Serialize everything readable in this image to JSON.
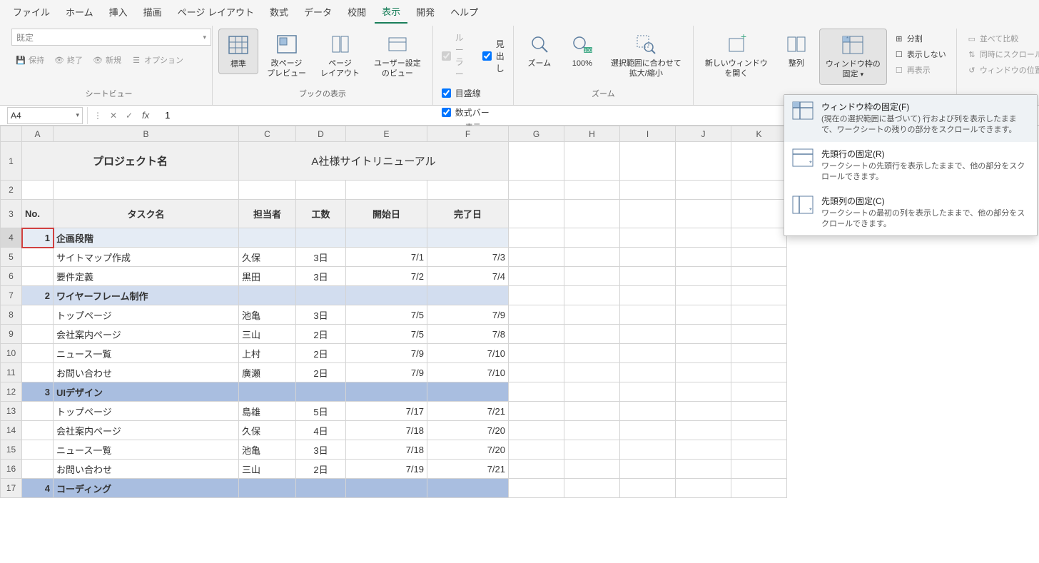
{
  "menu": {
    "items": [
      "ファイル",
      "ホーム",
      "挿入",
      "描画",
      "ページ レイアウト",
      "数式",
      "データ",
      "校閲",
      "表示",
      "開発",
      "ヘルプ"
    ],
    "active_index": 8
  },
  "ribbon": {
    "sheet_view": {
      "label": "シートビュー",
      "preset": "既定",
      "save": "保持",
      "exit": "終了",
      "new": "新規",
      "options": "オプション"
    },
    "workbook_views": {
      "label": "ブックの表示",
      "normal": "標準",
      "page_break": "改ページ\nプレビュー",
      "page_layout": "ページ\nレイアウト",
      "custom": "ユーザー設定\nのビュー"
    },
    "show": {
      "label": "表示",
      "ruler": "ルーラー",
      "headings": "見出し",
      "gridlines": "目盛線",
      "formula_bar": "数式バー"
    },
    "zoom": {
      "label": "ズーム",
      "zoom": "ズーム",
      "hundred": "100%",
      "selection": "選択範囲に合わせて\n拡大/縮小"
    },
    "window": {
      "new_window": "新しいウィンドウ\nを開く",
      "arrange": "整列",
      "freeze": "ウィンドウ枠の\n固定",
      "split": "分割",
      "hide": "表示しない",
      "unhide": "再表示",
      "side_by_side": "並べて比較",
      "sync_scroll": "同時にスクロール",
      "reset_pos": "ウィンドウの位置を元に戻す"
    }
  },
  "formula_bar": {
    "name_box": "A4",
    "formula": "1"
  },
  "freeze_popup": {
    "items": [
      {
        "title": "ウィンドウ枠の固定(F)",
        "desc": "(現在の選択範囲に基づいて) 行および列を表示したままで、ワークシートの残りの部分をスクロールできます。"
      },
      {
        "title": "先頭行の固定(R)",
        "desc": "ワークシートの先頭行を表示したままで、他の部分をスクロールできます。"
      },
      {
        "title": "先頭列の固定(C)",
        "desc": "ワークシートの最初の列を表示したままで、他の部分をスクロールできます。"
      }
    ]
  },
  "sheet": {
    "columns": [
      "A",
      "B",
      "C",
      "D",
      "E",
      "F",
      "G",
      "H",
      "I",
      "J",
      "K"
    ],
    "selected_cell": "A4",
    "title_row": {
      "label": "プロジェクト名",
      "value": "A社様サイトリニューアル"
    },
    "header_row": {
      "no": "No.",
      "task": "タスク名",
      "owner": "担当者",
      "effort": "工数",
      "start": "開始日",
      "end": "完了日"
    },
    "rows": [
      {
        "r": 4,
        "no": "1",
        "task": "企画段階",
        "owner": "",
        "effort": "",
        "start": "",
        "end": "",
        "section": 1
      },
      {
        "r": 5,
        "no": "",
        "task": "サイトマップ作成",
        "owner": "久保",
        "effort": "3日",
        "start": "7/1",
        "end": "7/3",
        "section": 0
      },
      {
        "r": 6,
        "no": "",
        "task": "要件定義",
        "owner": "黒田",
        "effort": "3日",
        "start": "7/2",
        "end": "7/4",
        "section": 0
      },
      {
        "r": 7,
        "no": "2",
        "task": "ワイヤーフレーム制作",
        "owner": "",
        "effort": "",
        "start": "",
        "end": "",
        "section": 2
      },
      {
        "r": 8,
        "no": "",
        "task": "トップページ",
        "owner": "池亀",
        "effort": "3日",
        "start": "7/5",
        "end": "7/9",
        "section": 0
      },
      {
        "r": 9,
        "no": "",
        "task": "会社案内ページ",
        "owner": "三山",
        "effort": "2日",
        "start": "7/5",
        "end": "7/8",
        "section": 0
      },
      {
        "r": 10,
        "no": "",
        "task": "ニュース一覧",
        "owner": "上村",
        "effort": "2日",
        "start": "7/9",
        "end": "7/10",
        "section": 0
      },
      {
        "r": 11,
        "no": "",
        "task": "お問い合わせ",
        "owner": "廣瀬",
        "effort": "2日",
        "start": "7/9",
        "end": "7/10",
        "section": 0
      },
      {
        "r": 12,
        "no": "3",
        "task": "UIデザイン",
        "owner": "",
        "effort": "",
        "start": "",
        "end": "",
        "section": 3
      },
      {
        "r": 13,
        "no": "",
        "task": "トップページ",
        "owner": "島雄",
        "effort": "5日",
        "start": "7/17",
        "end": "7/21",
        "section": 0
      },
      {
        "r": 14,
        "no": "",
        "task": "会社案内ページ",
        "owner": "久保",
        "effort": "4日",
        "start": "7/18",
        "end": "7/20",
        "section": 0
      },
      {
        "r": 15,
        "no": "",
        "task": "ニュース一覧",
        "owner": "池亀",
        "effort": "3日",
        "start": "7/18",
        "end": "7/20",
        "section": 0
      },
      {
        "r": 16,
        "no": "",
        "task": "お問い合わせ",
        "owner": "三山",
        "effort": "2日",
        "start": "7/19",
        "end": "7/21",
        "section": 0
      },
      {
        "r": 17,
        "no": "4",
        "task": "コーディング",
        "owner": "",
        "effort": "",
        "start": "",
        "end": "",
        "section": 3
      }
    ]
  }
}
